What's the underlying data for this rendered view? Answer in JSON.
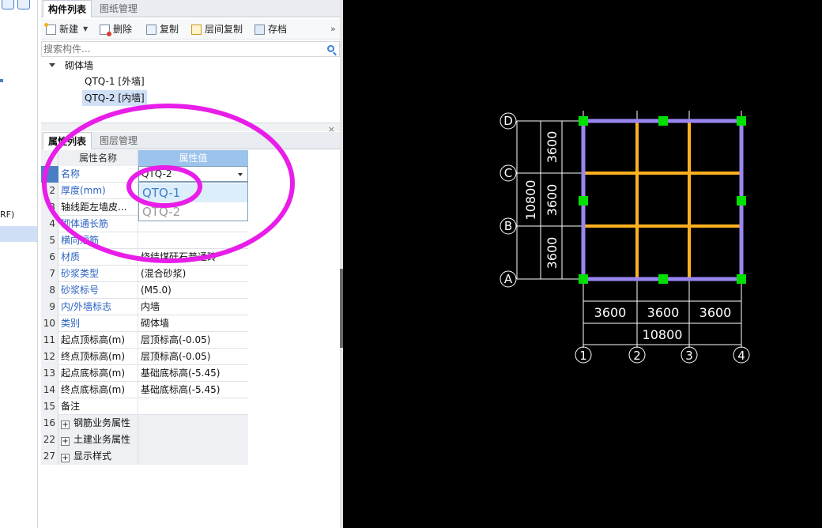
{
  "panel": {
    "tabs_top": [
      "构件列表",
      "图纸管理"
    ],
    "toolbar": {
      "new": "新建",
      "delete": "删除",
      "copy": "复制",
      "floor_copy": "层间复制",
      "save": "存档",
      "more": "»"
    },
    "search": {
      "placeholder": "搜索构件..."
    },
    "tree": {
      "root": "砌体墙",
      "items": [
        "QTQ-1 [外墙]",
        "QTQ-2 [内墙]"
      ],
      "selected_index": 1
    },
    "tabs_bottom": [
      "属性列表",
      "图层管理"
    ],
    "close_glyph": "×"
  },
  "left_strip": {
    "fragment": "RF)"
  },
  "grid": {
    "headers": {
      "name": "属性名称",
      "value": "属性值"
    },
    "rows": [
      {
        "num": "1",
        "name": "名称",
        "value": "QTQ-2",
        "blue": true
      },
      {
        "num": "2",
        "name": "厚度(mm)",
        "value": "",
        "blue": true
      },
      {
        "num": "3",
        "name": "轴线距左墙皮...",
        "value": "",
        "blue": false
      },
      {
        "num": "4",
        "name": "砌体通长筋",
        "value": "",
        "blue": true
      },
      {
        "num": "5",
        "name": "横向短筋",
        "value": "",
        "blue": true
      },
      {
        "num": "6",
        "name": "材质",
        "value": "烧结煤矸石普通砖",
        "blue": true
      },
      {
        "num": "7",
        "name": "砂浆类型",
        "value": "(混合砂浆)",
        "blue": true
      },
      {
        "num": "8",
        "name": "砂浆标号",
        "value": "(M5.0)",
        "blue": true
      },
      {
        "num": "9",
        "name": "内/外墙标志",
        "value": "内墙",
        "blue": true
      },
      {
        "num": "10",
        "name": "类别",
        "value": "砌体墙",
        "blue": true
      },
      {
        "num": "11",
        "name": "起点顶标高(m)",
        "value": "层顶标高(-0.05)",
        "blue": false
      },
      {
        "num": "12",
        "name": "终点顶标高(m)",
        "value": "层顶标高(-0.05)",
        "blue": false
      },
      {
        "num": "13",
        "name": "起点底标高(m)",
        "value": "基础底标高(-5.45)",
        "blue": false
      },
      {
        "num": "14",
        "name": "终点底标高(m)",
        "value": "基础底标高(-5.45)",
        "blue": false
      },
      {
        "num": "15",
        "name": "备注",
        "value": "",
        "blue": false
      },
      {
        "num": "16",
        "name": "钢筋业务属性",
        "value": "",
        "group": true
      },
      {
        "num": "22",
        "name": "土建业务属性",
        "value": "",
        "group": true
      },
      {
        "num": "27",
        "name": "显示样式",
        "value": "",
        "group": true
      }
    ]
  },
  "dropdown": {
    "value": "QTQ-2",
    "options": [
      "QTQ-1",
      "QTQ-2"
    ],
    "hover_index": 0
  },
  "cad": {
    "axes_letters": [
      "A",
      "B",
      "C",
      "D"
    ],
    "axes_numbers": [
      "1",
      "2",
      "3",
      "4"
    ],
    "spans_x": [
      "3600",
      "3600",
      "3600"
    ],
    "total_x": "10800",
    "spans_y": [
      "3600",
      "3600",
      "3600"
    ],
    "total_y": "10800"
  },
  "colors": {
    "annotation": "#e81ee8",
    "outer_wall": "#9a86f0",
    "inner_wall": "#ffb020",
    "node": "#00e000",
    "cad_lines": "#ffffff",
    "header_value_bg": "#9cc3ec"
  }
}
